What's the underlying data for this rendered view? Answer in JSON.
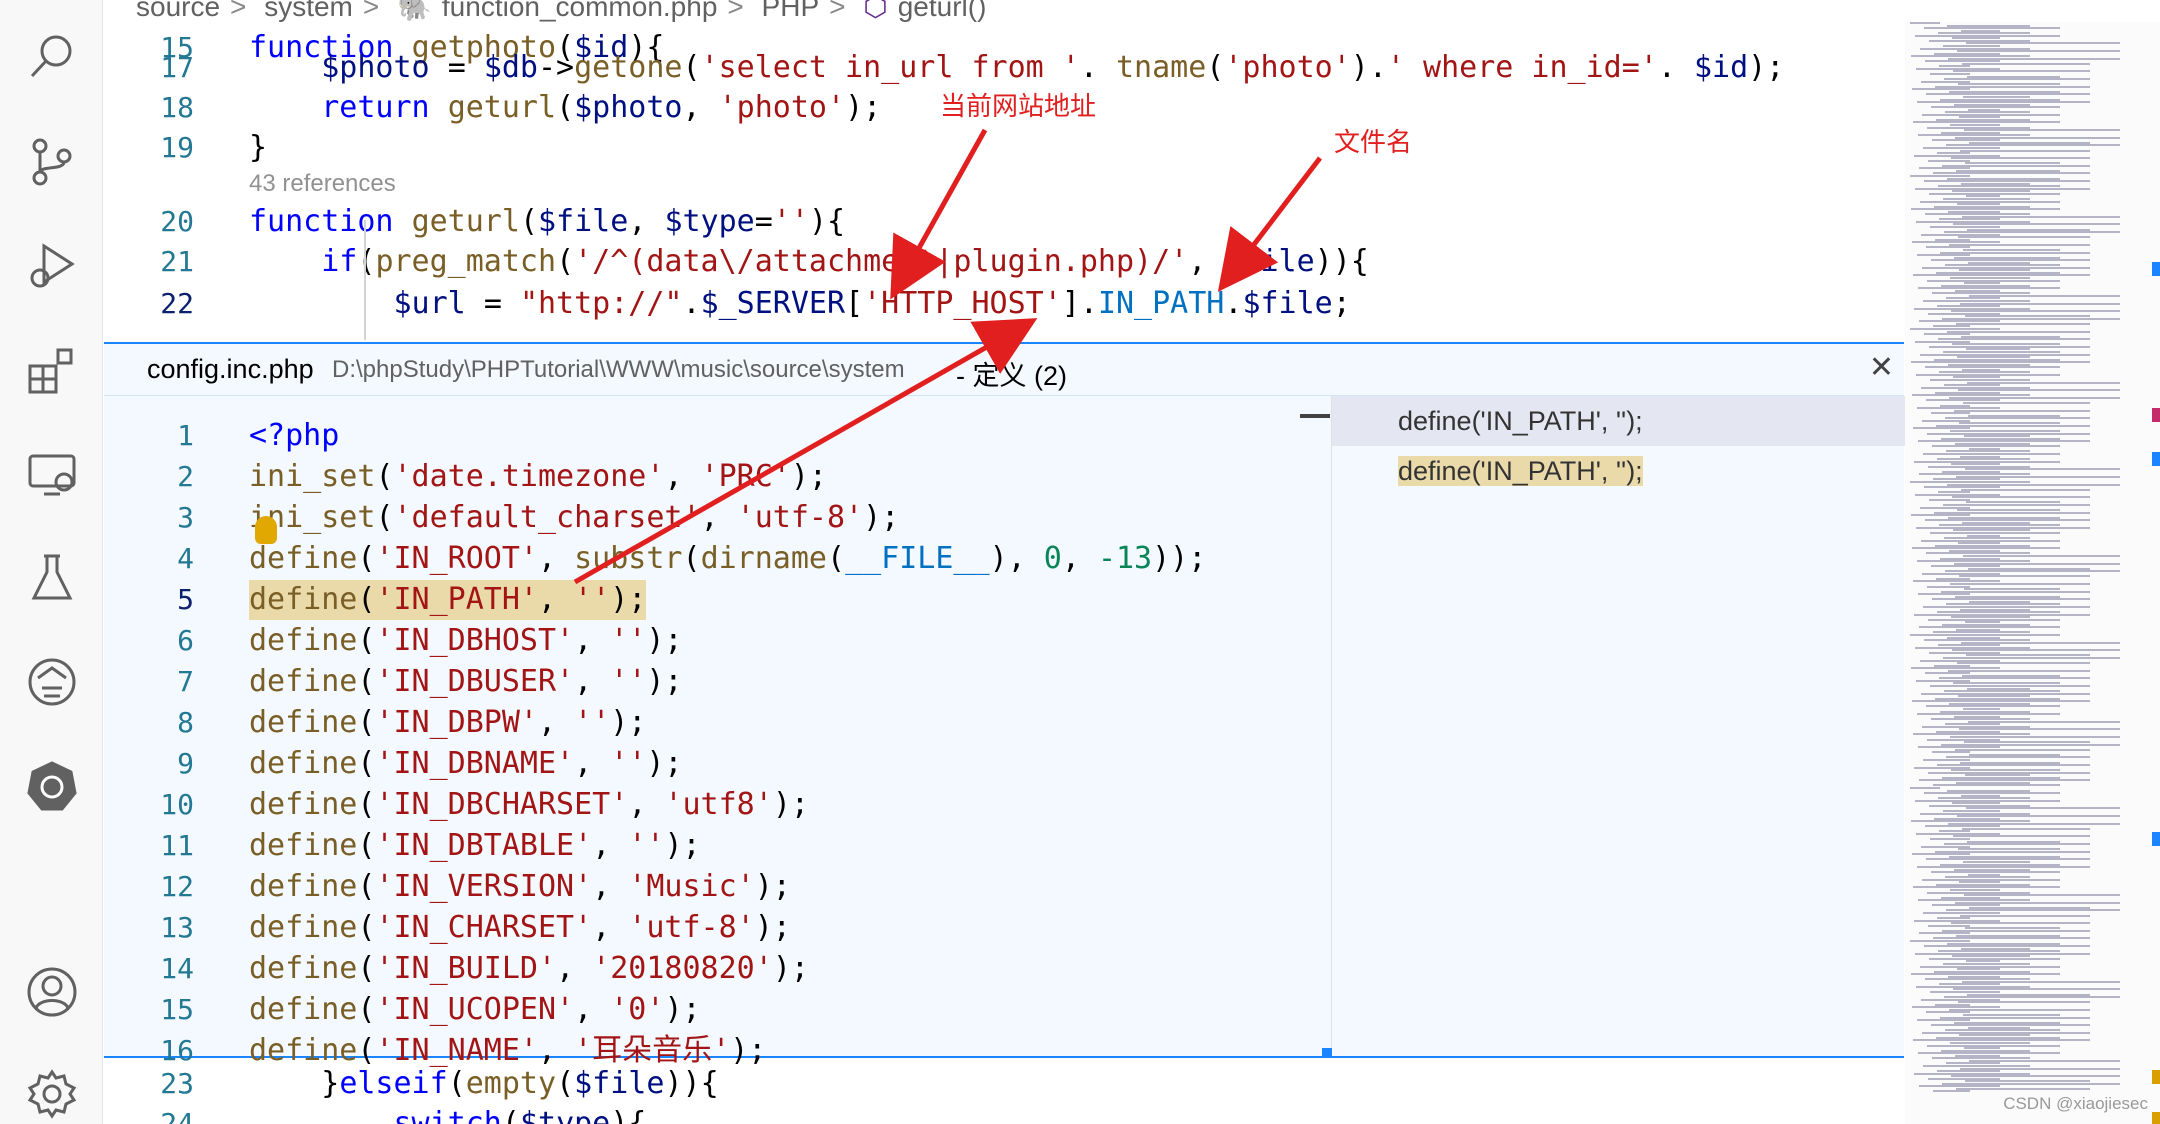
{
  "breadcrumb": [
    "source",
    "system",
    "function_common.php",
    "PHP",
    "geturl()"
  ],
  "editor_top": {
    "lines": [
      {
        "num": "15",
        "tokens": [
          [
            "kw",
            "function "
          ],
          [
            "fn",
            "getphoto"
          ],
          [
            "",
            "("
          ],
          [
            "var",
            "$id"
          ],
          [
            "",
            "){"
          ]
        ]
      },
      {
        "num": "17",
        "tokens": [
          [
            "var",
            "    $photo "
          ],
          [
            "",
            "= "
          ],
          [
            "var",
            "$db"
          ],
          [
            "",
            "->"
          ],
          [
            "fn",
            "getone"
          ],
          [
            "",
            "("
          ],
          [
            "str",
            "'select in_url from '"
          ],
          [
            "",
            ". "
          ],
          [
            "fn",
            "tname"
          ],
          [
            "",
            "("
          ],
          [
            "str",
            "'photo'"
          ],
          [
            "",
            ")."
          ],
          [
            "str",
            "' where in_id='"
          ],
          [
            "",
            ". "
          ],
          [
            "var",
            "$id"
          ],
          [
            "",
            ");"
          ]
        ]
      },
      {
        "num": "18",
        "tokens": [
          [
            "kw",
            "    return "
          ],
          [
            "fn",
            "geturl"
          ],
          [
            "",
            "("
          ],
          [
            "var",
            "$photo"
          ],
          [
            "",
            ", "
          ],
          [
            "str",
            "'photo'"
          ],
          [
            "",
            ");"
          ]
        ]
      },
      {
        "num": "19",
        "tokens": [
          [
            "",
            "}"
          ]
        ]
      },
      {
        "num": "20",
        "tokens": [
          [
            "kw",
            "function "
          ],
          [
            "fn",
            "geturl"
          ],
          [
            "",
            "("
          ],
          [
            "var",
            "$file"
          ],
          [
            "",
            ", "
          ],
          [
            "var",
            "$type"
          ],
          [
            "",
            "="
          ],
          [
            "str",
            "''"
          ],
          [
            "",
            "){"
          ]
        ]
      },
      {
        "num": "21",
        "tokens": [
          [
            "kw",
            "    if"
          ],
          [
            "",
            "("
          ],
          [
            "fn",
            "preg_match"
          ],
          [
            "",
            "("
          ],
          [
            "str",
            "'/^(data\\/attachment|plugin.php)/'"
          ],
          [
            "",
            ", "
          ],
          [
            "var",
            "$file"
          ],
          [
            "",
            "))"
          ],
          [
            "",
            "{"
          ]
        ]
      },
      {
        "num": "22",
        "tokens": [
          [
            "var",
            "        $url "
          ],
          [
            "",
            "= "
          ],
          [
            "str",
            "\"http://\""
          ],
          [
            "",
            "."
          ],
          [
            "var",
            "$_SERVER"
          ],
          [
            "",
            "["
          ],
          [
            "str",
            "'HTTP_HOST'"
          ],
          [
            "",
            "]."
          ],
          [
            "const",
            "IN_PATH"
          ],
          [
            "",
            "."
          ],
          [
            "var",
            "$file"
          ],
          [
            "",
            ";"
          ]
        ]
      }
    ],
    "references_label": "43 references"
  },
  "peek": {
    "file": "config.inc.php",
    "path": "D:\\phpStudy\\PHPTutorial\\WWW\\music\\source\\system",
    "count_label": "- 定义 (2)",
    "close": "✕",
    "lines": [
      {
        "num": "1",
        "tokens": [
          [
            "kw",
            "<?php"
          ]
        ]
      },
      {
        "num": "2",
        "tokens": [
          [
            "fn",
            "ini_set"
          ],
          [
            "",
            "("
          ],
          [
            "str",
            "'date.timezone'"
          ],
          [
            "",
            ", "
          ],
          [
            "str",
            "'PRC'"
          ],
          [
            "",
            ");"
          ]
        ]
      },
      {
        "num": "3",
        "tokens": [
          [
            "fn",
            "ini_set"
          ],
          [
            "",
            "("
          ],
          [
            "str",
            "'default_charset'"
          ],
          [
            "",
            ", "
          ],
          [
            "str",
            "'utf-8'"
          ],
          [
            "",
            ");"
          ]
        ]
      },
      {
        "num": "4",
        "tokens": [
          [
            "fn",
            "define"
          ],
          [
            "",
            "("
          ],
          [
            "str",
            "'IN_ROOT'"
          ],
          [
            "",
            ", "
          ],
          [
            "fn",
            "substr"
          ],
          [
            "",
            "("
          ],
          [
            "fn",
            "dirname"
          ],
          [
            "",
            "("
          ],
          [
            "const",
            "__FILE__"
          ],
          [
            "",
            "), "
          ],
          [
            "num",
            "0"
          ],
          [
            "",
            ", "
          ],
          [
            "num",
            "-13"
          ],
          [
            "",
            "));"
          ]
        ]
      },
      {
        "num": "5",
        "tokens": [
          [
            "fn",
            "define"
          ],
          [
            "",
            "("
          ],
          [
            "str",
            "'IN_PATH'"
          ],
          [
            "",
            ", "
          ],
          [
            "str",
            "''"
          ],
          [
            "",
            ");"
          ]
        ]
      },
      {
        "num": "6",
        "tokens": [
          [
            "fn",
            "define"
          ],
          [
            "",
            "("
          ],
          [
            "str",
            "'IN_DBHOST'"
          ],
          [
            "",
            ", "
          ],
          [
            "str",
            "''"
          ],
          [
            "",
            ");"
          ]
        ]
      },
      {
        "num": "7",
        "tokens": [
          [
            "fn",
            "define"
          ],
          [
            "",
            "("
          ],
          [
            "str",
            "'IN_DBUSER'"
          ],
          [
            "",
            ", "
          ],
          [
            "str",
            "''"
          ],
          [
            "",
            ");"
          ]
        ]
      },
      {
        "num": "8",
        "tokens": [
          [
            "fn",
            "define"
          ],
          [
            "",
            "("
          ],
          [
            "str",
            "'IN_DBPW'"
          ],
          [
            "",
            ", "
          ],
          [
            "str",
            "''"
          ],
          [
            "",
            ");"
          ]
        ]
      },
      {
        "num": "9",
        "tokens": [
          [
            "fn",
            "define"
          ],
          [
            "",
            "("
          ],
          [
            "str",
            "'IN_DBNAME'"
          ],
          [
            "",
            ", "
          ],
          [
            "str",
            "''"
          ],
          [
            "",
            ");"
          ]
        ]
      },
      {
        "num": "10",
        "tokens": [
          [
            "fn",
            "define"
          ],
          [
            "",
            "("
          ],
          [
            "str",
            "'IN_DBCHARSET'"
          ],
          [
            "",
            ", "
          ],
          [
            "str",
            "'utf8'"
          ],
          [
            "",
            ");"
          ]
        ]
      },
      {
        "num": "11",
        "tokens": [
          [
            "fn",
            "define"
          ],
          [
            "",
            "("
          ],
          [
            "str",
            "'IN_DBTABLE'"
          ],
          [
            "",
            ", "
          ],
          [
            "str",
            "''"
          ],
          [
            "",
            ");"
          ]
        ]
      },
      {
        "num": "12",
        "tokens": [
          [
            "fn",
            "define"
          ],
          [
            "",
            "("
          ],
          [
            "str",
            "'IN_VERSION'"
          ],
          [
            "",
            ", "
          ],
          [
            "str",
            "'Music'"
          ],
          [
            "",
            ");"
          ]
        ]
      },
      {
        "num": "13",
        "tokens": [
          [
            "fn",
            "define"
          ],
          [
            "",
            "("
          ],
          [
            "str",
            "'IN_CHARSET'"
          ],
          [
            "",
            ", "
          ],
          [
            "str",
            "'utf-8'"
          ],
          [
            "",
            ");"
          ]
        ]
      },
      {
        "num": "14",
        "tokens": [
          [
            "fn",
            "define"
          ],
          [
            "",
            "("
          ],
          [
            "str",
            "'IN_BUILD'"
          ],
          [
            "",
            ", "
          ],
          [
            "str",
            "'20180820'"
          ],
          [
            "",
            ");"
          ]
        ]
      },
      {
        "num": "15",
        "tokens": [
          [
            "fn",
            "define"
          ],
          [
            "",
            "("
          ],
          [
            "str",
            "'IN_UCOPEN'"
          ],
          [
            "",
            ", "
          ],
          [
            "str",
            "'0'"
          ],
          [
            "",
            ");"
          ]
        ]
      },
      {
        "num": "16",
        "tokens": [
          [
            "fn",
            "define"
          ],
          [
            "",
            "("
          ],
          [
            "str",
            "'IN_NAME'"
          ],
          [
            "",
            ", "
          ],
          [
            "str",
            "'耳朵音乐'"
          ],
          [
            "",
            ");"
          ]
        ]
      }
    ],
    "refs": [
      "define('IN_PATH', '');",
      "define('IN_PATH', '');"
    ]
  },
  "editor_bottom": {
    "lines": [
      {
        "num": "23",
        "tokens": [
          [
            "",
            "    }"
          ],
          [
            "kw",
            "elseif"
          ],
          [
            "",
            "("
          ],
          [
            "fn",
            "empty"
          ],
          [
            "",
            "("
          ],
          [
            "var",
            "$file"
          ],
          [
            "",
            "))"
          ],
          [
            "",
            "{"
          ]
        ]
      },
      {
        "num": "24",
        "tokens": [
          [
            "kw",
            "        switch"
          ],
          [
            "",
            "("
          ],
          [
            "var",
            "$type"
          ],
          [
            "",
            "){"
          ]
        ]
      }
    ]
  },
  "annotations": {
    "site_address": "当前网站地址",
    "file_name": "文件名"
  },
  "watermark": "CSDN @xiaojiesec",
  "colors": {
    "keyword": "#0000ff",
    "function": "#795e26",
    "variable": "#001080",
    "string": "#a31515",
    "number": "#098658",
    "annotation": "#e11f1f",
    "peek_border": "#1a85ff"
  }
}
